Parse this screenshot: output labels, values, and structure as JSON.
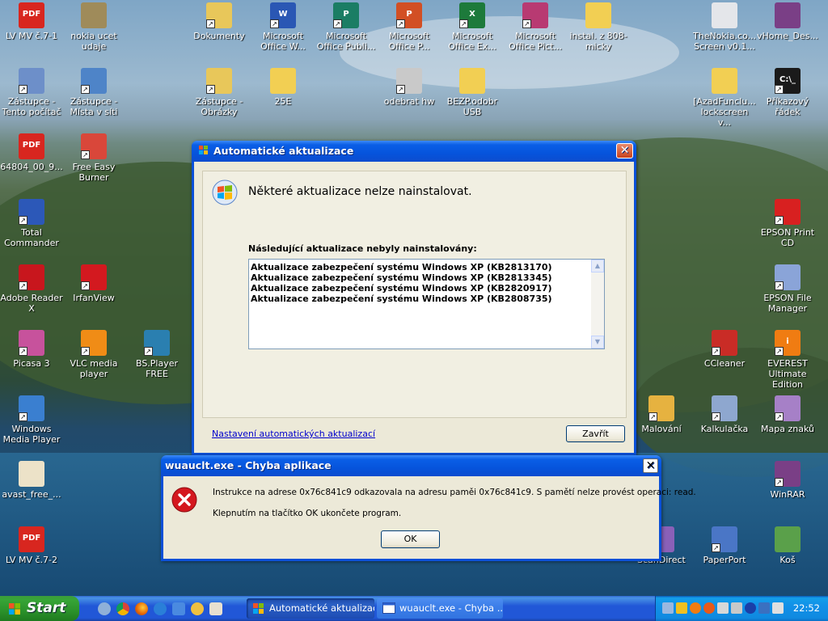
{
  "desktop_icons": [
    {
      "name": "lv-mv-1",
      "label": "LV MV č.7-1",
      "color": "#d8261f",
      "glyph": "PDF",
      "shortcut": false
    },
    {
      "name": "nokia-ucet",
      "label": "nokia ucet udaje",
      "color": "#9f8b5a",
      "glyph": "",
      "shortcut": false
    },
    {
      "name": "dokumenty",
      "label": "Dokumenty",
      "color": "#e8c75a",
      "glyph": "",
      "shortcut": true
    },
    {
      "name": "office-word",
      "label": "Microsoft Office W...",
      "color": "#2a57b4",
      "glyph": "W",
      "shortcut": true
    },
    {
      "name": "office-publisher",
      "label": "Microsoft Office Publi...",
      "color": "#1b7d64",
      "glyph": "P",
      "shortcut": true
    },
    {
      "name": "office-powerpoint",
      "label": "Microsoft Office P...",
      "color": "#d24f24",
      "glyph": "P",
      "shortcut": true
    },
    {
      "name": "office-excel",
      "label": "Microsoft Office Ex...",
      "color": "#1d7a3b",
      "glyph": "X",
      "shortcut": true
    },
    {
      "name": "office-picture",
      "label": "Microsoft Office Pict...",
      "color": "#b83a72",
      "glyph": "",
      "shortcut": true
    },
    {
      "name": "instal-folder",
      "label": "instal. z 808-micky",
      "color": "#f2cf53",
      "glyph": "",
      "shortcut": false
    },
    {
      "name": "thenokia",
      "label": "TheNokia.co... Screen v0.1...",
      "color": "#e4e6ea",
      "glyph": "",
      "shortcut": false
    },
    {
      "name": "vhome",
      "label": "vHome_Des...",
      "color": "#7a3f86",
      "glyph": "",
      "shortcut": false
    },
    {
      "name": "tento-pocitac",
      "label": "Zástupce - Tento počítač",
      "color": "#6d8fc9",
      "glyph": "",
      "shortcut": true
    },
    {
      "name": "mista-v-siti",
      "label": "Zástupce - Místa v síti",
      "color": "#4e84c8",
      "glyph": "",
      "shortcut": true
    },
    {
      "name": "obrazky",
      "label": "Zástupce - Obrázky",
      "color": "#e8c75a",
      "glyph": "",
      "shortcut": true
    },
    {
      "name": "folder-25e",
      "label": "25E",
      "color": "#f2cf53",
      "glyph": "",
      "shortcut": false
    },
    {
      "name": "odebrat-hw",
      "label": "odebrat hw",
      "color": "#c9c9c9",
      "glyph": "",
      "shortcut": true
    },
    {
      "name": "bezp-usb",
      "label": "BEZP.odobr USB",
      "color": "#f2cf53",
      "glyph": "",
      "shortcut": false
    },
    {
      "name": "azad-lockscreen",
      "label": "[AzadFunclu... lockscreen v...",
      "color": "#f2cf53",
      "glyph": "",
      "shortcut": false
    },
    {
      "name": "prikazovy-radek",
      "label": "Příkazový řádek",
      "color": "#1a1a1a",
      "glyph": "C:\\_",
      "shortcut": true
    },
    {
      "name": "pdf-64804",
      "label": "64804_00_9...",
      "color": "#d8261f",
      "glyph": "PDF",
      "shortcut": false
    },
    {
      "name": "free-easy-burner",
      "label": "Free Easy Burner",
      "color": "#d9473a",
      "glyph": "",
      "shortcut": true
    },
    {
      "name": "total-commander",
      "label": "Total Commander",
      "color": "#2c58b8",
      "glyph": "",
      "shortcut": true
    },
    {
      "name": "epson-print-cd",
      "label": "EPSON Print CD",
      "color": "#d82020",
      "glyph": "",
      "shortcut": true
    },
    {
      "name": "adobe-reader",
      "label": "Adobe Reader X",
      "color": "#c8161d",
      "glyph": "",
      "shortcut": true
    },
    {
      "name": "irfanview",
      "label": "IrfanView",
      "color": "#d3191f",
      "glyph": "",
      "shortcut": true
    },
    {
      "name": "epson-file-manager",
      "label": "EPSON File Manager",
      "color": "#8aa4d8",
      "glyph": "",
      "shortcut": true
    },
    {
      "name": "picasa",
      "label": "Picasa 3",
      "color": "#c7529c",
      "glyph": "",
      "shortcut": true
    },
    {
      "name": "vlc",
      "label": "VLC media player",
      "color": "#f08c16",
      "glyph": "",
      "shortcut": true
    },
    {
      "name": "bsplayer",
      "label": "BS.Player FREE",
      "color": "#2a7fb0",
      "glyph": "",
      "shortcut": true
    },
    {
      "name": "ccleaner",
      "label": "CCleaner",
      "color": "#c92c26",
      "glyph": "",
      "shortcut": true
    },
    {
      "name": "everest",
      "label": "EVEREST Ultimate Edition",
      "color": "#f07c12",
      "glyph": "i",
      "shortcut": true
    },
    {
      "name": "windows-media-player",
      "label": "Windows Media Player",
      "color": "#3a7fd0",
      "glyph": "",
      "shortcut": true
    },
    {
      "name": "malovani",
      "label": "Malování",
      "color": "#e6b240",
      "glyph": "",
      "shortcut": true
    },
    {
      "name": "kalkulacka",
      "label": "Kalkulačka",
      "color": "#8ea7cf",
      "glyph": "",
      "shortcut": true
    },
    {
      "name": "mapa-znaku",
      "label": "Mapa znaků",
      "color": "#a680c7",
      "glyph": "",
      "shortcut": true
    },
    {
      "name": "avast-free",
      "label": "avast_free_...",
      "color": "#ece2c8",
      "glyph": "",
      "shortcut": false
    },
    {
      "name": "winrar",
      "label": "WinRAR",
      "color": "#7a3f86",
      "glyph": "",
      "shortcut": true
    },
    {
      "name": "lv-mv-2",
      "label": "LV MV č.7-2",
      "color": "#d8261f",
      "glyph": "PDF",
      "shortcut": false
    },
    {
      "name": "scandirect",
      "label": "ScanDirect",
      "color": "#8a60b8",
      "glyph": "",
      "shortcut": true
    },
    {
      "name": "paperport",
      "label": "PaperPort",
      "color": "#4a76c6",
      "glyph": "",
      "shortcut": true
    },
    {
      "name": "kos",
      "label": "Koš",
      "color": "#5aa04a",
      "glyph": "",
      "shortcut": false
    }
  ],
  "update_window": {
    "title": "Automatické aktualizace",
    "heading": "Některé aktualizace nelze nainstalovat.",
    "list_label": "Následující aktualizace nebyly nainstalovány:",
    "items": [
      "Aktualizace zabezpečení systému Windows XP (KB2813170)",
      "Aktualizace zabezpečení systému Windows XP (KB2813345)",
      "Aktualizace zabezpečení systému Windows XP (KB2820917)",
      "Aktualizace zabezpečení systému Windows XP (KB2808735)"
    ],
    "settings_link": "Nastavení automatických aktualizací",
    "close_label": "Zavřít"
  },
  "error_window": {
    "title": "wuauclt.exe - Chyba aplikace",
    "message": "Instrukce na adrese 0x76c841c9 odkazovala na adresu paměi 0x76c841c9. S pamětí nelze provést operaci: read.",
    "hint": "Klepnutím na tlačítko OK ukončete program.",
    "ok_label": "OK"
  },
  "taskbar": {
    "start_label": "Start",
    "tasks": [
      {
        "label": "Automatické aktualizace",
        "active": true
      },
      {
        "label": "wuauclt.exe - Chyba ...",
        "active": false
      }
    ],
    "clock": "22:52"
  },
  "colors": {
    "titlebar": "#0654dc",
    "link": "#0000cc",
    "error": "#d4181f"
  }
}
